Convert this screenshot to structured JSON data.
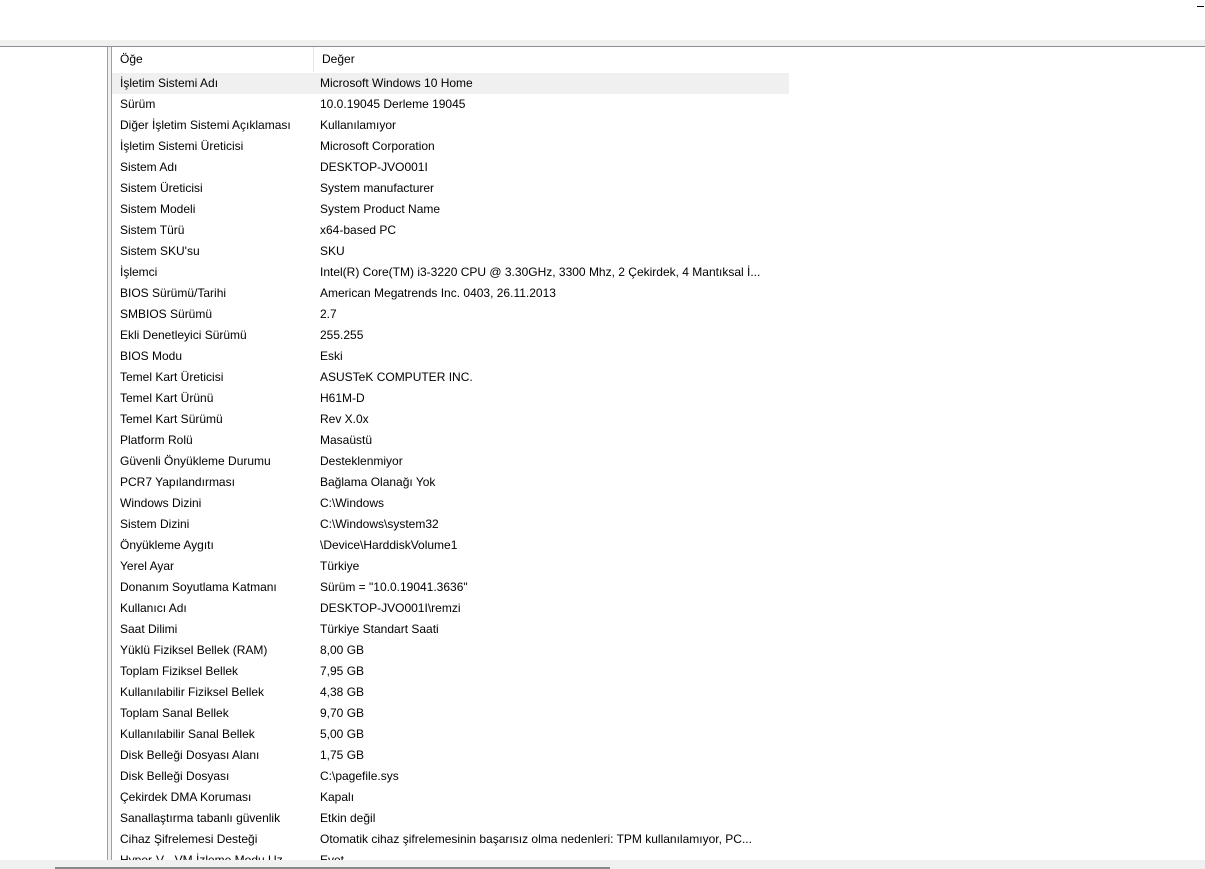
{
  "table": {
    "columns": [
      "Öğe",
      "Değer"
    ],
    "selected_row": 0,
    "rows": [
      [
        "İşletim Sistemi Adı",
        "Microsoft Windows 10 Home"
      ],
      [
        "Sürüm",
        "10.0.19045 Derleme 19045"
      ],
      [
        "Diğer İşletim Sistemi Açıklaması",
        "Kullanılamıyor"
      ],
      [
        "İşletim Sistemi Üreticisi",
        "Microsoft Corporation"
      ],
      [
        "Sistem Adı",
        "DESKTOP-JVO001I"
      ],
      [
        "Sistem Üreticisi",
        "System manufacturer"
      ],
      [
        "Sistem Modeli",
        "System Product Name"
      ],
      [
        "Sistem Türü",
        "x64-based PC"
      ],
      [
        "Sistem SKU'su",
        "SKU"
      ],
      [
        "İşlemci",
        "Intel(R) Core(TM) i3-3220 CPU @ 3.30GHz, 3300 Mhz, 2 Çekirdek, 4 Mantıksal İ..."
      ],
      [
        "BIOS Sürümü/Tarihi",
        "American Megatrends Inc. 0403, 26.11.2013"
      ],
      [
        "SMBIOS Sürümü",
        "2.7"
      ],
      [
        "Ekli Denetleyici Sürümü",
        "255.255"
      ],
      [
        "BIOS Modu",
        "Eski"
      ],
      [
        "Temel Kart Üreticisi",
        "ASUSTeK COMPUTER INC."
      ],
      [
        "Temel Kart Ürünü",
        "H61M-D"
      ],
      [
        "Temel Kart Sürümü",
        "Rev X.0x"
      ],
      [
        "Platform Rolü",
        "Masaüstü"
      ],
      [
        "Güvenli Önyükleme Durumu",
        "Desteklenmiyor"
      ],
      [
        "PCR7 Yapılandırması",
        "Bağlama Olanağı Yok"
      ],
      [
        "Windows Dizini",
        "C:\\Windows"
      ],
      [
        "Sistem Dizini",
        "C:\\Windows\\system32"
      ],
      [
        "Önyükleme Aygıtı",
        "\\Device\\HarddiskVolume1"
      ],
      [
        "Yerel Ayar",
        "Türkiye"
      ],
      [
        "Donanım Soyutlama Katmanı",
        "Sürüm = \"10.0.19041.3636\""
      ],
      [
        "Kullanıcı Adı",
        "DESKTOP-JVO001I\\remzi"
      ],
      [
        "Saat Dilimi",
        "Türkiye Standart Saati"
      ],
      [
        "Yüklü Fiziksel Bellek (RAM)",
        "8,00 GB"
      ],
      [
        "Toplam Fiziksel Bellek",
        "7,95 GB"
      ],
      [
        "Kullanılabilir Fiziksel Bellek",
        "4,38 GB"
      ],
      [
        "Toplam Sanal Bellek",
        "9,70 GB"
      ],
      [
        "Kullanılabilir Sanal Bellek",
        "5,00 GB"
      ],
      [
        "Disk Belleği Dosyası Alanı",
        "1,75 GB"
      ],
      [
        "Disk Belleği Dosyası",
        "C:\\pagefile.sys"
      ],
      [
        "Çekirdek DMA Koruması",
        "Kapalı"
      ],
      [
        "Sanallaştırma tabanlı güvenlik",
        "Etkin değil"
      ],
      [
        "Cihaz Şifrelemesi Desteği",
        "Otomatik cihaz şifrelemesinin başarısız olma nedenleri: TPM kullanılamıyor, PC..."
      ],
      [
        "Hyper-V - VM İzleme Modu Uz...",
        "Evet"
      ]
    ]
  }
}
